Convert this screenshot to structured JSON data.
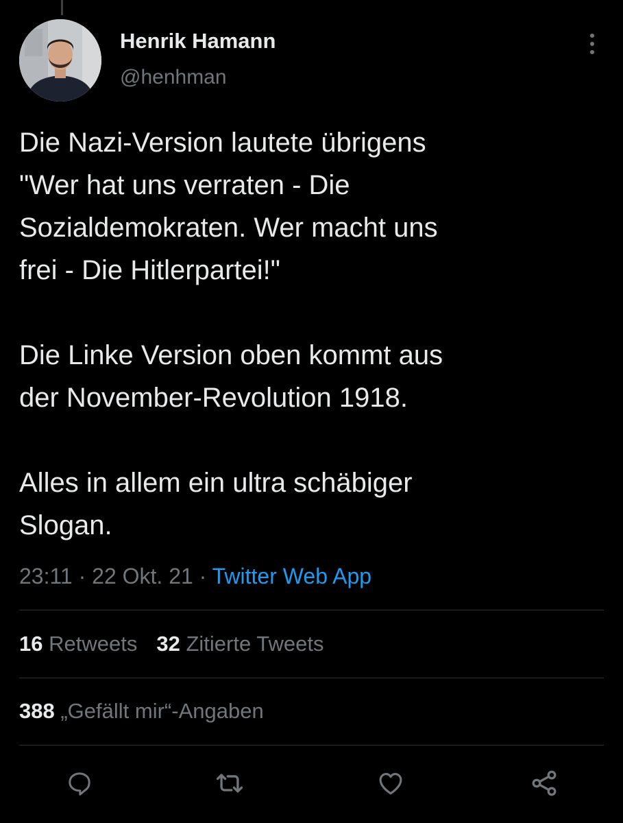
{
  "tweet": {
    "author": {
      "name": "Henrik Hamann",
      "handle": "@henhman"
    },
    "paragraphs": [
      "Die Nazi-Version lautete übrigens\n\"Wer hat uns verraten - Die\nSozialdemokraten. Wer macht uns\nfrei - Die Hitlerpartei!\"",
      "Die Linke Version oben kommt aus\nder November-Revolution 1918.",
      "Alles in allem ein ultra schäbiger\nSlogan."
    ],
    "time": "23:11",
    "date": "22 Okt. 21",
    "separator": "·",
    "source": "Twitter Web App"
  },
  "stats": {
    "retweets_count": "16",
    "retweets_label": "Retweets",
    "quotes_count": "32",
    "quotes_label": "Zitierte Tweets",
    "likes_count": "388",
    "likes_label": "„Gefällt mir“-Angaben"
  },
  "icons": {
    "more": "more-vertical-icon",
    "reply": "reply-icon",
    "retweet": "retweet-icon",
    "like": "heart-icon",
    "share": "share-icon"
  },
  "colors": {
    "background": "#000000",
    "text": "#e7e9ea",
    "secondary": "#71767b",
    "accent": "#1d9bf0",
    "divider": "#2f3336"
  }
}
